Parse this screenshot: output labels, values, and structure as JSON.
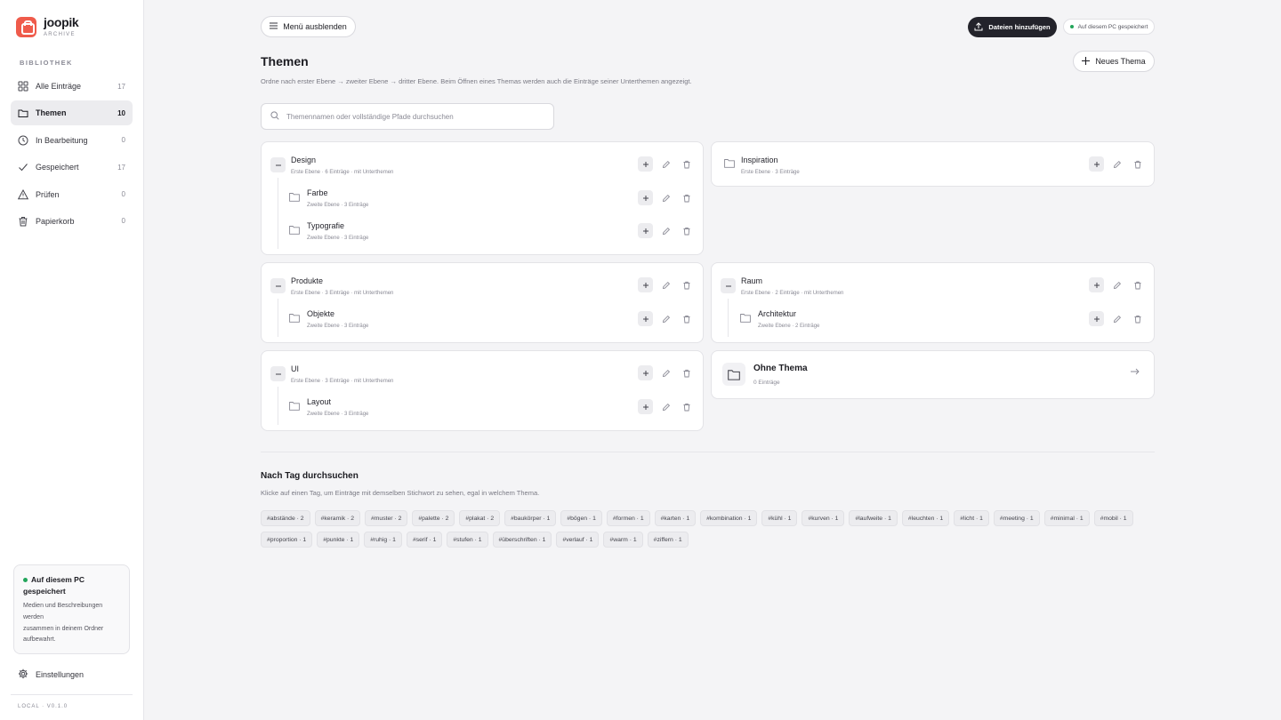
{
  "brand": {
    "name": "joopik",
    "subtitle": "ARCHIVE"
  },
  "sidebar": {
    "section_label": "BIBLIOTHEK",
    "items": [
      {
        "label": "Alle Einträge",
        "count": "17",
        "icon": "grid-icon"
      },
      {
        "label": "Themen",
        "count": "10",
        "icon": "folder-icon"
      },
      {
        "label": "In Bearbeitung",
        "count": "0",
        "icon": "clock-icon"
      },
      {
        "label": "Gespeichert",
        "count": "17",
        "icon": "check-icon"
      },
      {
        "label": "Prüfen",
        "count": "0",
        "icon": "warning-icon"
      },
      {
        "label": "Papierkorb",
        "count": "0",
        "icon": "trash-icon"
      }
    ],
    "info_box": {
      "title": "Auf diesem PC gespeichert",
      "text_lines": [
        "Medien und Beschreibungen",
        "werden",
        "zusammen in deinem Ordner",
        "aufbewahrt."
      ]
    },
    "settings_label": "Einstellungen",
    "version": "LOCAL · V0.1.0"
  },
  "toolbar": {
    "menu_label": "Menü ausblenden",
    "upload_label": "Dateien hinzufügen",
    "status_label": "Auf diesem PC gespeichert"
  },
  "header": {
    "title": "Themen",
    "description": "Ordne nach erster Ebene → zweiter Ebene → dritter Ebene. Beim Öffnen eines Themas werden auch die Einträge seiner Unterthemen angezeigt.",
    "new_label": "Neues Thema"
  },
  "search": {
    "placeholder": "Themennamen oder vollständige Pfade durchsuchen"
  },
  "themes": [
    {
      "name": "Design",
      "meta": "Erste Ebene · 6 Einträge · mit Unterthemen",
      "children": [
        {
          "name": "Farbe",
          "meta": "Zweite Ebene · 3 Einträge"
        },
        {
          "name": "Typografie",
          "meta": "Zweite Ebene · 3 Einträge"
        }
      ]
    },
    {
      "name": "Inspiration",
      "meta": "Erste Ebene · 3 Einträge",
      "children": []
    },
    {
      "name": "Produkte",
      "meta": "Erste Ebene · 3 Einträge · mit Unterthemen",
      "children": [
        {
          "name": "Objekte",
          "meta": "Zweite Ebene · 3 Einträge"
        }
      ]
    },
    {
      "name": "Raum",
      "meta": "Erste Ebene · 2 Einträge · mit Unterthemen",
      "children": [
        {
          "name": "Architektur",
          "meta": "Zweite Ebene · 2 Einträge"
        }
      ]
    },
    {
      "name": "UI",
      "meta": "Erste Ebene · 3 Einträge · mit Unterthemen",
      "children": [
        {
          "name": "Layout",
          "meta": "Zweite Ebene · 3 Einträge"
        }
      ]
    }
  ],
  "no_theme": {
    "title": "Ohne Thema",
    "count": "0 Einträge"
  },
  "tags_section": {
    "title": "Nach Tag durchsuchen",
    "description": "Klicke auf einen Tag, um Einträge mit demselben Stichwort zu sehen, egal in welchem Thema.",
    "tags": [
      "#abstände · 2",
      "#keramik · 2",
      "#muster · 2",
      "#palette · 2",
      "#plakat · 2",
      "#baukörper · 1",
      "#bögen · 1",
      "#formen · 1",
      "#karten · 1",
      "#kombination · 1",
      "#kühl · 1",
      "#kurven · 1",
      "#laufweite · 1",
      "#leuchten · 1",
      "#licht · 1",
      "#meeting · 1",
      "#minimal · 1",
      "#mobil · 1",
      "#proportion · 1",
      "#punkte · 1",
      "#ruhig · 1",
      "#serif · 1",
      "#stufen · 1",
      "#überschriften · 1",
      "#verlauf · 1",
      "#warm · 1",
      "#ziffern · 1"
    ]
  },
  "colors": {
    "accent": "#ef5b4b",
    "dark_button": "#23232b",
    "status_dot": "#22a55a"
  }
}
